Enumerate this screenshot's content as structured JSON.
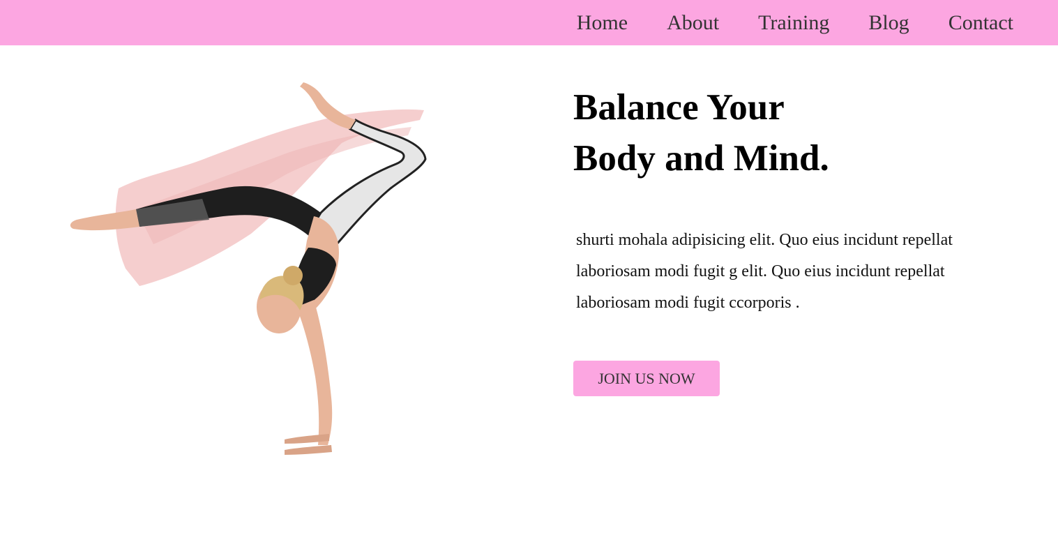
{
  "nav": {
    "items": [
      {
        "label": "Home"
      },
      {
        "label": "About"
      },
      {
        "label": "Training"
      },
      {
        "label": "Blog"
      },
      {
        "label": "Contact"
      }
    ]
  },
  "hero": {
    "headline_line1": "Balance Your",
    "headline_line2": "Body and Mind.",
    "body": "shurti mohala adipisicing elit. Quo eius incidunt repellat laboriosam modi fugit g elit. Quo eius incidunt repellat laboriosam modi fugit ccorporis .",
    "cta_label": "JOIN US NOW",
    "image_description": "woman in handstand yoga pose over pink watercolor brush stroke"
  },
  "colors": {
    "nav_background": "#fca6e1",
    "button_background": "#fca6e1",
    "brush_stroke": "#f3c6c6",
    "text": "#000000"
  }
}
